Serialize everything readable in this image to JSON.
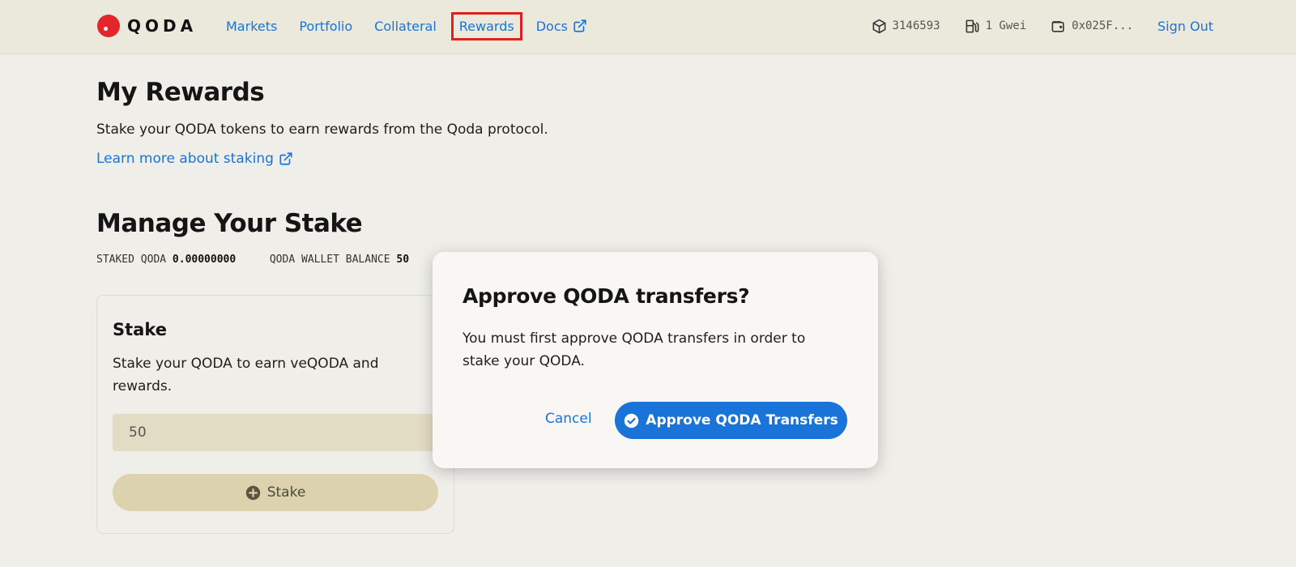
{
  "header": {
    "logo_text": "QODA",
    "nav": [
      {
        "label": "Markets"
      },
      {
        "label": "Portfolio"
      },
      {
        "label": "Collateral"
      },
      {
        "label": "Rewards"
      },
      {
        "label": "Docs"
      }
    ],
    "status": {
      "block": "3146593",
      "gas": "1 Gwei",
      "wallet": "0x025F..."
    },
    "sign_out": "Sign Out"
  },
  "rewards": {
    "title": "My Rewards",
    "description": "Stake your QODA tokens to earn rewards from the Qoda protocol.",
    "learn_more": "Learn more about staking"
  },
  "manage": {
    "title": "Manage Your Stake",
    "staked_label": "STAKED QODA",
    "staked_value": "0.00000000",
    "balance_label": "QODA WALLET BALANCE",
    "balance_value": "50"
  },
  "stake_card": {
    "title": "Stake",
    "description": "Stake your QODA to earn veQODA and rewards.",
    "input_value": "50",
    "button_label": "Stake"
  },
  "modal": {
    "title": "Approve QODA transfers?",
    "body": "You must first approve QODA transfers in order to stake your QODA.",
    "cancel_label": "Cancel",
    "approve_label": "Approve QODA Transfers"
  },
  "colors": {
    "accent": "#1a73d9",
    "logo_red": "#e3262b",
    "header_bg": "#ebe8dc",
    "page_bg": "#efeee9"
  }
}
